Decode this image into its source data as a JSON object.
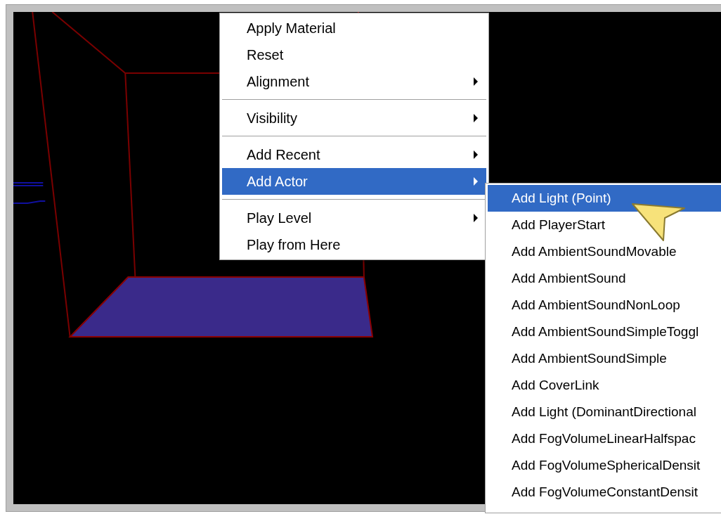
{
  "context_menu": {
    "items": [
      {
        "kind": "item",
        "label": "Apply Material",
        "submenu": false,
        "selected": false
      },
      {
        "kind": "item",
        "label": "Reset",
        "submenu": false,
        "selected": false
      },
      {
        "kind": "item",
        "label": "Alignment",
        "submenu": true,
        "selected": false
      },
      {
        "kind": "separator"
      },
      {
        "kind": "item",
        "label": "Visibility",
        "submenu": true,
        "selected": false
      },
      {
        "kind": "separator"
      },
      {
        "kind": "item",
        "label": "Add Recent",
        "submenu": true,
        "selected": false
      },
      {
        "kind": "item",
        "label": "Add Actor",
        "submenu": true,
        "selected": true
      },
      {
        "kind": "separator"
      },
      {
        "kind": "item",
        "label": "Play Level",
        "submenu": true,
        "selected": false
      },
      {
        "kind": "item",
        "label": "Play from Here",
        "submenu": false,
        "selected": false
      }
    ]
  },
  "submenu": {
    "items": [
      {
        "label": "Add Light (Point)",
        "selected": true
      },
      {
        "label": "Add PlayerStart",
        "selected": false
      },
      {
        "label": "Add AmbientSoundMovable",
        "selected": false
      },
      {
        "label": "Add AmbientSound",
        "selected": false
      },
      {
        "label": "Add AmbientSoundNonLoop",
        "selected": false
      },
      {
        "label": "Add AmbientSoundSimpleToggl",
        "selected": false
      },
      {
        "label": "Add AmbientSoundSimple",
        "selected": false
      },
      {
        "label": "Add CoverLink",
        "selected": false
      },
      {
        "label": "Add Light (DominantDirectional",
        "selected": false
      },
      {
        "label": "Add FogVolumeLinearHalfspac",
        "selected": false
      },
      {
        "label": "Add FogVolumeSphericalDensit",
        "selected": false
      },
      {
        "label": "Add FogVolumeConstantDensit",
        "selected": false
      }
    ]
  }
}
